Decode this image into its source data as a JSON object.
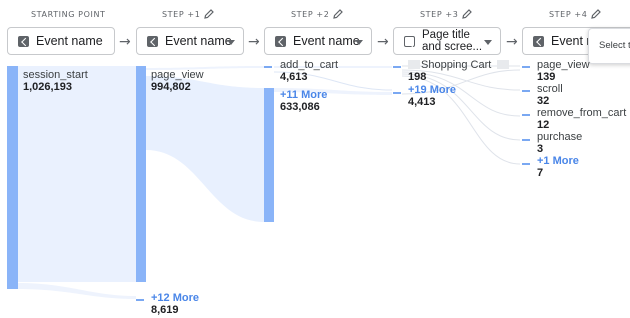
{
  "steps": [
    {
      "header": "STARTING POINT",
      "chip": "Event name"
    },
    {
      "header": "STEP +1",
      "chip": "Event name"
    },
    {
      "header": "STEP +2",
      "chip": "Event name"
    },
    {
      "header": "STEP +3",
      "chip_line1": "Page title",
      "chip_line2": "and scree..."
    },
    {
      "header": "STEP +4",
      "chip": "Event na"
    }
  ],
  "tooltip": "Select tl",
  "nodes": {
    "start": {
      "name": "session_start",
      "value": "1,026,193"
    },
    "s1": {
      "name": "page_view",
      "value": "994,802"
    },
    "s1_more": {
      "label": "+12 More",
      "value": "8,619"
    },
    "s2": {
      "name": "add_to_cart",
      "value": "4,613"
    },
    "s2_more": {
      "label": "+11 More",
      "value": "633,086"
    },
    "s3": {
      "name": "Shopping Cart",
      "value": "198"
    },
    "s3_more": {
      "label": "+19 More",
      "value": "4,413"
    },
    "s4": [
      {
        "name": "page_view",
        "value": "139"
      },
      {
        "name": "scroll",
        "value": "32"
      },
      {
        "name": "remove_from_cart",
        "value": "12"
      },
      {
        "name": "purchase",
        "value": "3"
      }
    ],
    "s4_more": {
      "label": "+1 More",
      "value": "7"
    }
  },
  "colors": {
    "bar": "#8ab4f8",
    "flow": "#e8f0fe",
    "more": "#4a86e8"
  },
  "icons": [
    "pencil-icon",
    "arrow-right-icon",
    "event-icon",
    "page-icon",
    "dropdown-icon"
  ]
}
